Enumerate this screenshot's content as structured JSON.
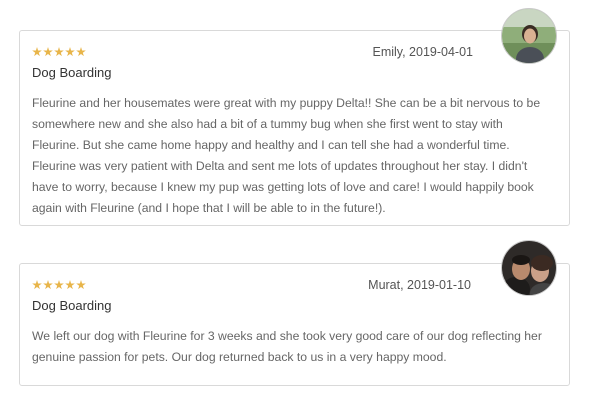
{
  "reviews": [
    {
      "rating": 5,
      "author_date": "Emily, 2019-04-01",
      "service": "Dog Boarding",
      "text": "Fleurine and her housemates were great with my puppy Delta!! She can be a bit nervous to be somewhere new and she also had a bit of a tummy bug when she first went to stay with Fleurine. But she came home happy and healthy and I can tell she had a wonderful time. Fleurine was very patient with Delta and sent me lots of updates throughout her stay. I didn't have to worry, because I knew my pup was getting lots of love and care! I would happily book again with Fleurine (and I hope that I will be able to in the future!).",
      "avatar_icon": "reviewer-photo-avatar"
    },
    {
      "rating": 5,
      "author_date": "Murat, 2019-01-10",
      "service": "Dog Boarding",
      "text": "We left our dog with Fleurine for 3 weeks and she took very good care of our dog reflecting her genuine passion for pets. Our dog returned back to us in a very happy mood.",
      "avatar_icon": "reviewer-photo-avatar"
    }
  ],
  "colors": {
    "star": "#e8b54a",
    "card_border": "#d9d9d9",
    "text": "#666666"
  }
}
